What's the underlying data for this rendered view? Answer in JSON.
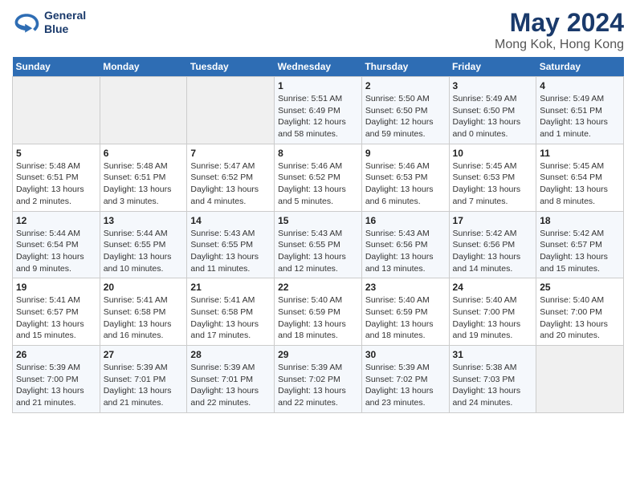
{
  "header": {
    "logo_line1": "General",
    "logo_line2": "Blue",
    "title": "May 2024",
    "subtitle": "Mong Kok, Hong Kong"
  },
  "weekdays": [
    "Sunday",
    "Monday",
    "Tuesday",
    "Wednesday",
    "Thursday",
    "Friday",
    "Saturday"
  ],
  "weeks": [
    [
      {
        "day": "",
        "info": ""
      },
      {
        "day": "",
        "info": ""
      },
      {
        "day": "",
        "info": ""
      },
      {
        "day": "1",
        "info": "Sunrise: 5:51 AM\nSunset: 6:49 PM\nDaylight: 12 hours\nand 58 minutes."
      },
      {
        "day": "2",
        "info": "Sunrise: 5:50 AM\nSunset: 6:50 PM\nDaylight: 12 hours\nand 59 minutes."
      },
      {
        "day": "3",
        "info": "Sunrise: 5:49 AM\nSunset: 6:50 PM\nDaylight: 13 hours\nand 0 minutes."
      },
      {
        "day": "4",
        "info": "Sunrise: 5:49 AM\nSunset: 6:51 PM\nDaylight: 13 hours\nand 1 minute."
      }
    ],
    [
      {
        "day": "5",
        "info": "Sunrise: 5:48 AM\nSunset: 6:51 PM\nDaylight: 13 hours\nand 2 minutes."
      },
      {
        "day": "6",
        "info": "Sunrise: 5:48 AM\nSunset: 6:51 PM\nDaylight: 13 hours\nand 3 minutes."
      },
      {
        "day": "7",
        "info": "Sunrise: 5:47 AM\nSunset: 6:52 PM\nDaylight: 13 hours\nand 4 minutes."
      },
      {
        "day": "8",
        "info": "Sunrise: 5:46 AM\nSunset: 6:52 PM\nDaylight: 13 hours\nand 5 minutes."
      },
      {
        "day": "9",
        "info": "Sunrise: 5:46 AM\nSunset: 6:53 PM\nDaylight: 13 hours\nand 6 minutes."
      },
      {
        "day": "10",
        "info": "Sunrise: 5:45 AM\nSunset: 6:53 PM\nDaylight: 13 hours\nand 7 minutes."
      },
      {
        "day": "11",
        "info": "Sunrise: 5:45 AM\nSunset: 6:54 PM\nDaylight: 13 hours\nand 8 minutes."
      }
    ],
    [
      {
        "day": "12",
        "info": "Sunrise: 5:44 AM\nSunset: 6:54 PM\nDaylight: 13 hours\nand 9 minutes."
      },
      {
        "day": "13",
        "info": "Sunrise: 5:44 AM\nSunset: 6:55 PM\nDaylight: 13 hours\nand 10 minutes."
      },
      {
        "day": "14",
        "info": "Sunrise: 5:43 AM\nSunset: 6:55 PM\nDaylight: 13 hours\nand 11 minutes."
      },
      {
        "day": "15",
        "info": "Sunrise: 5:43 AM\nSunset: 6:55 PM\nDaylight: 13 hours\nand 12 minutes."
      },
      {
        "day": "16",
        "info": "Sunrise: 5:43 AM\nSunset: 6:56 PM\nDaylight: 13 hours\nand 13 minutes."
      },
      {
        "day": "17",
        "info": "Sunrise: 5:42 AM\nSunset: 6:56 PM\nDaylight: 13 hours\nand 14 minutes."
      },
      {
        "day": "18",
        "info": "Sunrise: 5:42 AM\nSunset: 6:57 PM\nDaylight: 13 hours\nand 15 minutes."
      }
    ],
    [
      {
        "day": "19",
        "info": "Sunrise: 5:41 AM\nSunset: 6:57 PM\nDaylight: 13 hours\nand 15 minutes."
      },
      {
        "day": "20",
        "info": "Sunrise: 5:41 AM\nSunset: 6:58 PM\nDaylight: 13 hours\nand 16 minutes."
      },
      {
        "day": "21",
        "info": "Sunrise: 5:41 AM\nSunset: 6:58 PM\nDaylight: 13 hours\nand 17 minutes."
      },
      {
        "day": "22",
        "info": "Sunrise: 5:40 AM\nSunset: 6:59 PM\nDaylight: 13 hours\nand 18 minutes."
      },
      {
        "day": "23",
        "info": "Sunrise: 5:40 AM\nSunset: 6:59 PM\nDaylight: 13 hours\nand 18 minutes."
      },
      {
        "day": "24",
        "info": "Sunrise: 5:40 AM\nSunset: 7:00 PM\nDaylight: 13 hours\nand 19 minutes."
      },
      {
        "day": "25",
        "info": "Sunrise: 5:40 AM\nSunset: 7:00 PM\nDaylight: 13 hours\nand 20 minutes."
      }
    ],
    [
      {
        "day": "26",
        "info": "Sunrise: 5:39 AM\nSunset: 7:00 PM\nDaylight: 13 hours\nand 21 minutes."
      },
      {
        "day": "27",
        "info": "Sunrise: 5:39 AM\nSunset: 7:01 PM\nDaylight: 13 hours\nand 21 minutes."
      },
      {
        "day": "28",
        "info": "Sunrise: 5:39 AM\nSunset: 7:01 PM\nDaylight: 13 hours\nand 22 minutes."
      },
      {
        "day": "29",
        "info": "Sunrise: 5:39 AM\nSunset: 7:02 PM\nDaylight: 13 hours\nand 22 minutes."
      },
      {
        "day": "30",
        "info": "Sunrise: 5:39 AM\nSunset: 7:02 PM\nDaylight: 13 hours\nand 23 minutes."
      },
      {
        "day": "31",
        "info": "Sunrise: 5:38 AM\nSunset: 7:03 PM\nDaylight: 13 hours\nand 24 minutes."
      },
      {
        "day": "",
        "info": ""
      }
    ]
  ]
}
